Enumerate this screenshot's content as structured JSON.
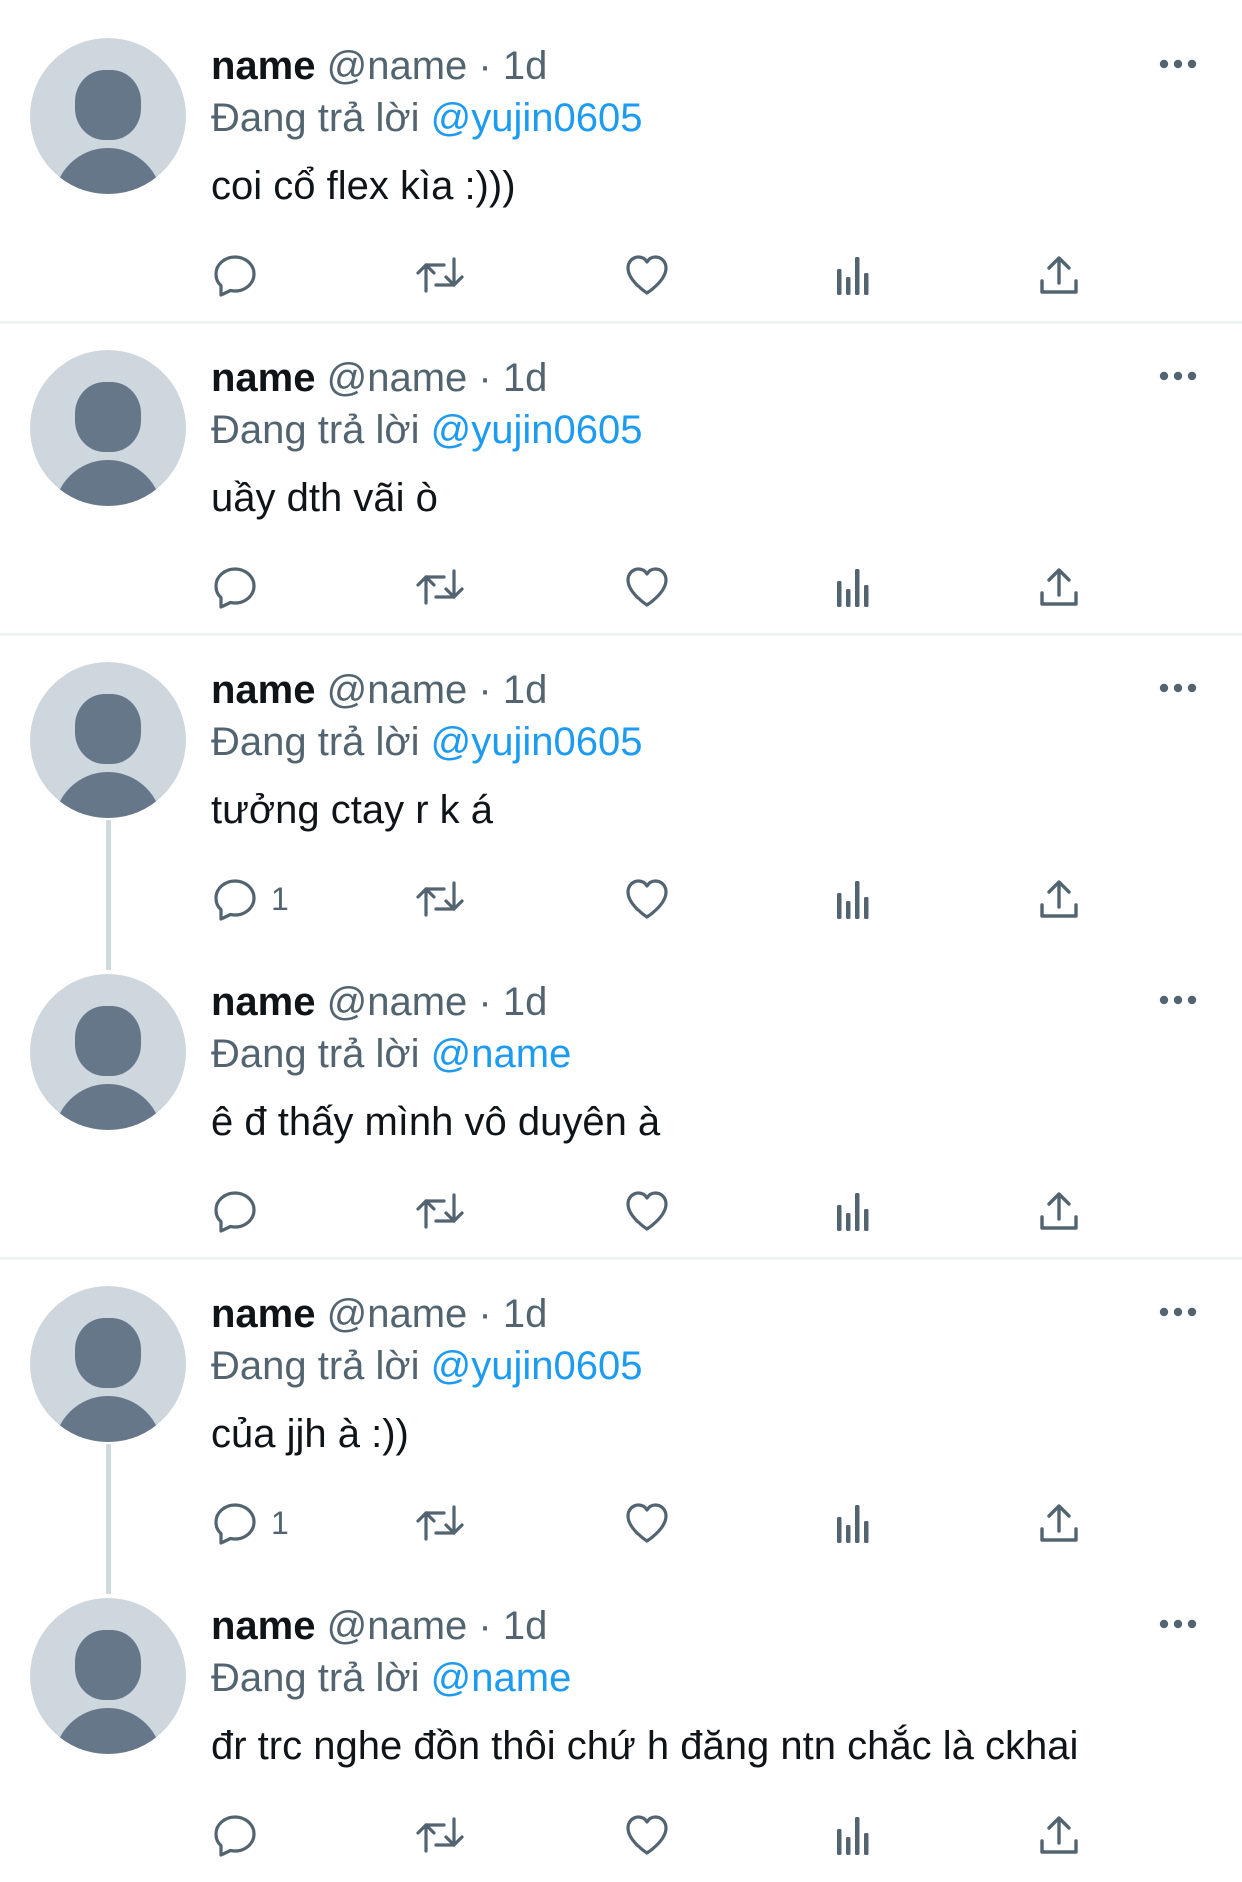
{
  "tweets": [
    {
      "name": "name",
      "handle": "@name",
      "separator": "·",
      "time": "1d",
      "reply_prefix": "Đang trả lời",
      "reply_to": "@yujin0605",
      "text": "coi cổ flex kìa :)))",
      "reply_count": ""
    },
    {
      "name": "name",
      "handle": "@name",
      "separator": "·",
      "time": "1d",
      "reply_prefix": "Đang trả lời",
      "reply_to": "@yujin0605",
      "text": "uầy dth vãi ò",
      "reply_count": ""
    },
    {
      "name": "name",
      "handle": "@name",
      "separator": "·",
      "time": "1d",
      "reply_prefix": "Đang trả lời",
      "reply_to": "@yujin0605",
      "text": "tưởng ctay r k á",
      "reply_count": "1"
    },
    {
      "name": "name",
      "handle": "@name",
      "separator": "·",
      "time": "1d",
      "reply_prefix": "Đang trả lời",
      "reply_to": "@name",
      "text": "ê đ thấy mình vô duyên à",
      "reply_count": ""
    },
    {
      "name": "name",
      "handle": "@name",
      "separator": "·",
      "time": "1d",
      "reply_prefix": "Đang trả lời",
      "reply_to": "@yujin0605",
      "text": "của jjh à :))",
      "reply_count": "1"
    },
    {
      "name": "name",
      "handle": "@name",
      "separator": "·",
      "time": "1d",
      "reply_prefix": "Đang trả lời",
      "reply_to": "@name",
      "text": "đr trc nghe đồn thôi chứ h đăng ntn chắc là ckhai",
      "reply_count": ""
    }
  ],
  "icons": {
    "more": "more-horizontal-icon",
    "reply": "reply-bubble-icon",
    "retweet": "retweet-icon",
    "like": "heart-icon",
    "views": "views-bar-chart-icon",
    "share": "share-upload-icon"
  },
  "colors": {
    "accent": "#1d9bf0",
    "text": "#0f1419",
    "muted": "#536471",
    "avatar_bg": "#ced7de",
    "avatar_fg": "#66778a",
    "divider": "#eff3f4",
    "thread_line": "#cfd9de"
  }
}
